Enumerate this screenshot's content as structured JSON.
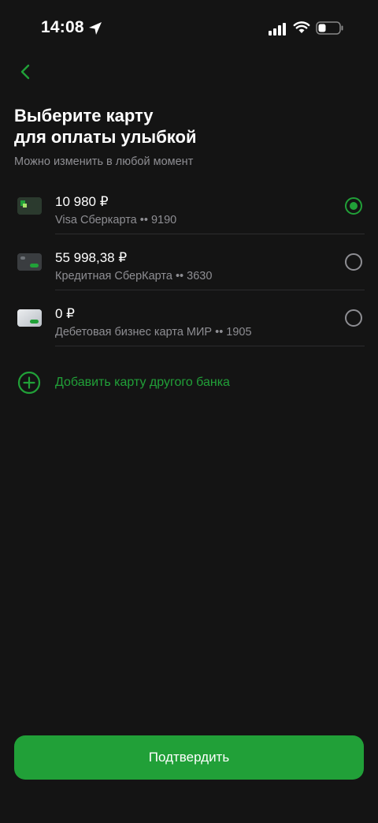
{
  "status_bar": {
    "time": "14:08",
    "icons": [
      "location-arrow-icon",
      "signal-icon",
      "wifi-icon",
      "battery-icon"
    ]
  },
  "header": {
    "back_icon": "chevron-left-icon",
    "title_line1": "Выберите карту",
    "title_line2": "для оплаты улыбкой",
    "subtitle": "Можно изменить в любой момент"
  },
  "cards": [
    {
      "amount": "10 980 ₽",
      "name": "Visa Сберкарта •• 9190",
      "selected": true
    },
    {
      "amount": "55 998,38 ₽",
      "name": "Кредитная СберКарта •• 3630",
      "selected": false
    },
    {
      "amount": "0 ₽",
      "name": "Дебетовая бизнес карта МИР •• 1905",
      "selected": false
    }
  ],
  "add_card": {
    "icon": "plus-circle-icon",
    "label": "Добавить карту другого банка"
  },
  "confirm_button": {
    "label": "Подтвердить"
  },
  "colors": {
    "background": "#141414",
    "accent": "#21a038",
    "secondary_text": "#8e8e93"
  }
}
